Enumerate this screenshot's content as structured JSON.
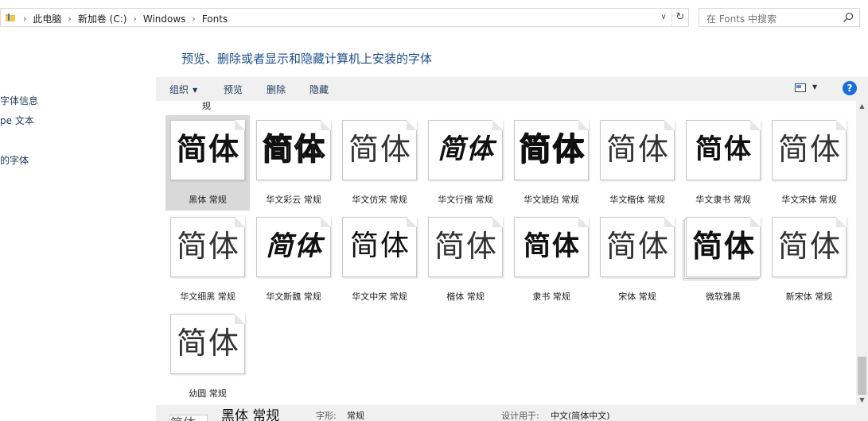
{
  "address": {
    "crumbs": [
      "此电脑",
      "新加卷 (C:)",
      "Windows",
      "Fonts"
    ],
    "separator": "›",
    "dropdown_glyph": "∨",
    "refresh_glyph": "↻"
  },
  "search": {
    "placeholder": "在 Fonts 中搜索"
  },
  "sidebar": {
    "items": [
      "字体信息",
      "pe 文本",
      "的字体"
    ]
  },
  "page_title": "预览、删除或者显示和隐藏计算机上安装的字体",
  "toolbar": {
    "organize": "组织",
    "preview": "预览",
    "delete": "删除",
    "hide": "隐藏",
    "help": "?"
  },
  "content": {
    "cut_label": "规",
    "sample_text": "简体",
    "fonts": [
      {
        "label": "黑体 常规",
        "style": "bold",
        "selected": true
      },
      {
        "label": "华文彩云 常规",
        "style": "outline"
      },
      {
        "label": "华文仿宋 常规",
        "style": "light"
      },
      {
        "label": "华文行楷 常规",
        "style": "brush"
      },
      {
        "label": "华文琥珀 常规",
        "style": "black"
      },
      {
        "label": "华文楷体 常规",
        "style": "light"
      },
      {
        "label": "华文隶书 常规",
        "style": "serif-bold"
      },
      {
        "label": "华文宋体 常规",
        "style": "light"
      },
      {
        "label": "华文细黑 常规",
        "style": "light"
      },
      {
        "label": "华文新魏 常规",
        "style": "brush"
      },
      {
        "label": "华文中宋 常规",
        "style": "serif"
      },
      {
        "label": "楷体 常规",
        "style": "light"
      },
      {
        "label": "隶书 常规",
        "style": "serif-bold"
      },
      {
        "label": "宋体 常规",
        "style": "light"
      },
      {
        "label": "微软雅黑",
        "style": "bold",
        "stacked": true
      },
      {
        "label": "新宋体 常规",
        "style": "light"
      },
      {
        "label": "幼圆 常规",
        "style": "light"
      }
    ]
  },
  "details": {
    "thumb_text": "简体",
    "name": "黑体 常规",
    "style_key": "字形:",
    "style_value": "常规",
    "designed_for_key": "设计用于:",
    "designed_for_value": "中文(简体中文)"
  },
  "scrollbar": {
    "up": "▲",
    "down": "▼"
  },
  "colors": {
    "accent": "#1e4e8c",
    "help": "#1a6fd6",
    "toolbar_bg": "#f0f0f0",
    "selected_bg": "#d9d9d9"
  }
}
